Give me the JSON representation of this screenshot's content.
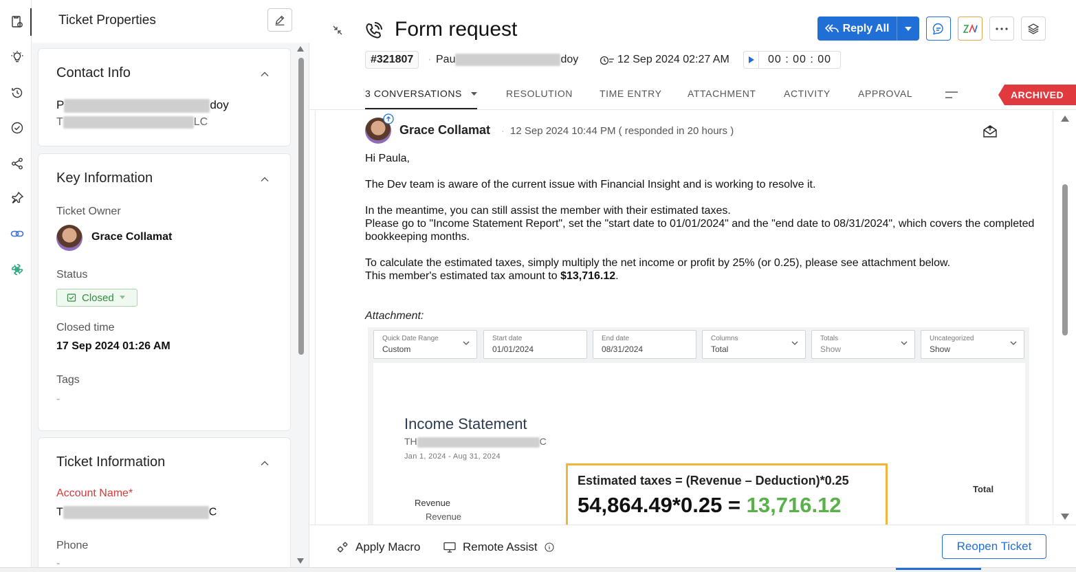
{
  "left_panel": {
    "title": "Ticket Properties",
    "contact_info": {
      "heading": "Contact Info",
      "name_prefix": "P",
      "name_suffix": "doy",
      "company_prefix": "T",
      "company_suffix": "LC"
    },
    "key_information": {
      "heading": "Key Information",
      "owner_label": "Ticket Owner",
      "owner_name": "Grace Collamat",
      "status_label": "Status",
      "status_value": "Closed",
      "closed_time_label": "Closed time",
      "closed_time_value": "17 Sep 2024 01:26 AM",
      "tags_label": "Tags",
      "tags_value": "-"
    },
    "ticket_information": {
      "heading": "Ticket Information",
      "account_label": "Account Name",
      "account_required": "*",
      "account_prefix": "T",
      "account_suffix": "C",
      "phone_label": "Phone",
      "phone_value": "-"
    }
  },
  "ticket": {
    "subject": "Form request",
    "number": "#321807",
    "contact_prefix": "Pau",
    "contact_suffix": "doy",
    "created": "12 Sep 2024 02:27 AM",
    "timer": "00 : 00 : 00",
    "reply_all_label": "Reply All",
    "archived_label": "ARCHIVED"
  },
  "tabs": [
    {
      "label": "3 CONVERSATIONS"
    },
    {
      "label": "RESOLUTION"
    },
    {
      "label": "TIME ENTRY"
    },
    {
      "label": "ATTACHMENT"
    },
    {
      "label": "ACTIVITY"
    },
    {
      "label": "APPROVAL"
    }
  ],
  "conversation": {
    "sender": "Grace Collamat",
    "sent_meta": "12 Sep 2024 10:44 PM ( responded in 20 hours )",
    "greeting": "Hi Paula,",
    "p1": "The Dev team is aware of the current issue with Financial Insight and is working to resolve it.",
    "p2": "In the meantime, you can still assist the member with their estimated taxes.",
    "p3": "Please go to \"Income Statement Report\", set the \"start date to 01/01/2024\" and the \"end date to 08/31/2024\", which covers the completed bookkeeping months.",
    "p4": "To calculate the estimated taxes, simply multiply the net income or profit by 25% (or 0.25), please see attachment below.",
    "p5_prefix": "This member's estimated tax amount to ",
    "p5_amount": "$13,716.12",
    "p5_suffix": ".",
    "attachment_label": "Attachment:"
  },
  "attachment": {
    "filters": [
      {
        "label": "Quick Date Range",
        "value": "Custom"
      },
      {
        "label": "Start date",
        "value": "01/01/2024"
      },
      {
        "label": "End date",
        "value": "08/31/2024"
      },
      {
        "label": "Columns",
        "value": "Total"
      },
      {
        "label": "Totals",
        "value": "Show"
      },
      {
        "label": "Uncategorized",
        "value": "Show"
      }
    ],
    "statement_title": "Income Statement",
    "company_prefix": "TH",
    "company_suffix": "C",
    "period": "Jan 1, 2024 - Aug 31, 2024",
    "revenue_heading": "Revenue",
    "revenue_sub": "Revenue",
    "total_label": "Total",
    "formula_line": "Estimated taxes = (Revenue – Deduction)*0.25",
    "formula_calc": "54,864.49*0.25 = ",
    "formula_result": "13,716.12"
  },
  "footer": {
    "apply_macro": "Apply Macro",
    "remote_assist": "Remote Assist",
    "reopen": "Reopen Ticket"
  }
}
